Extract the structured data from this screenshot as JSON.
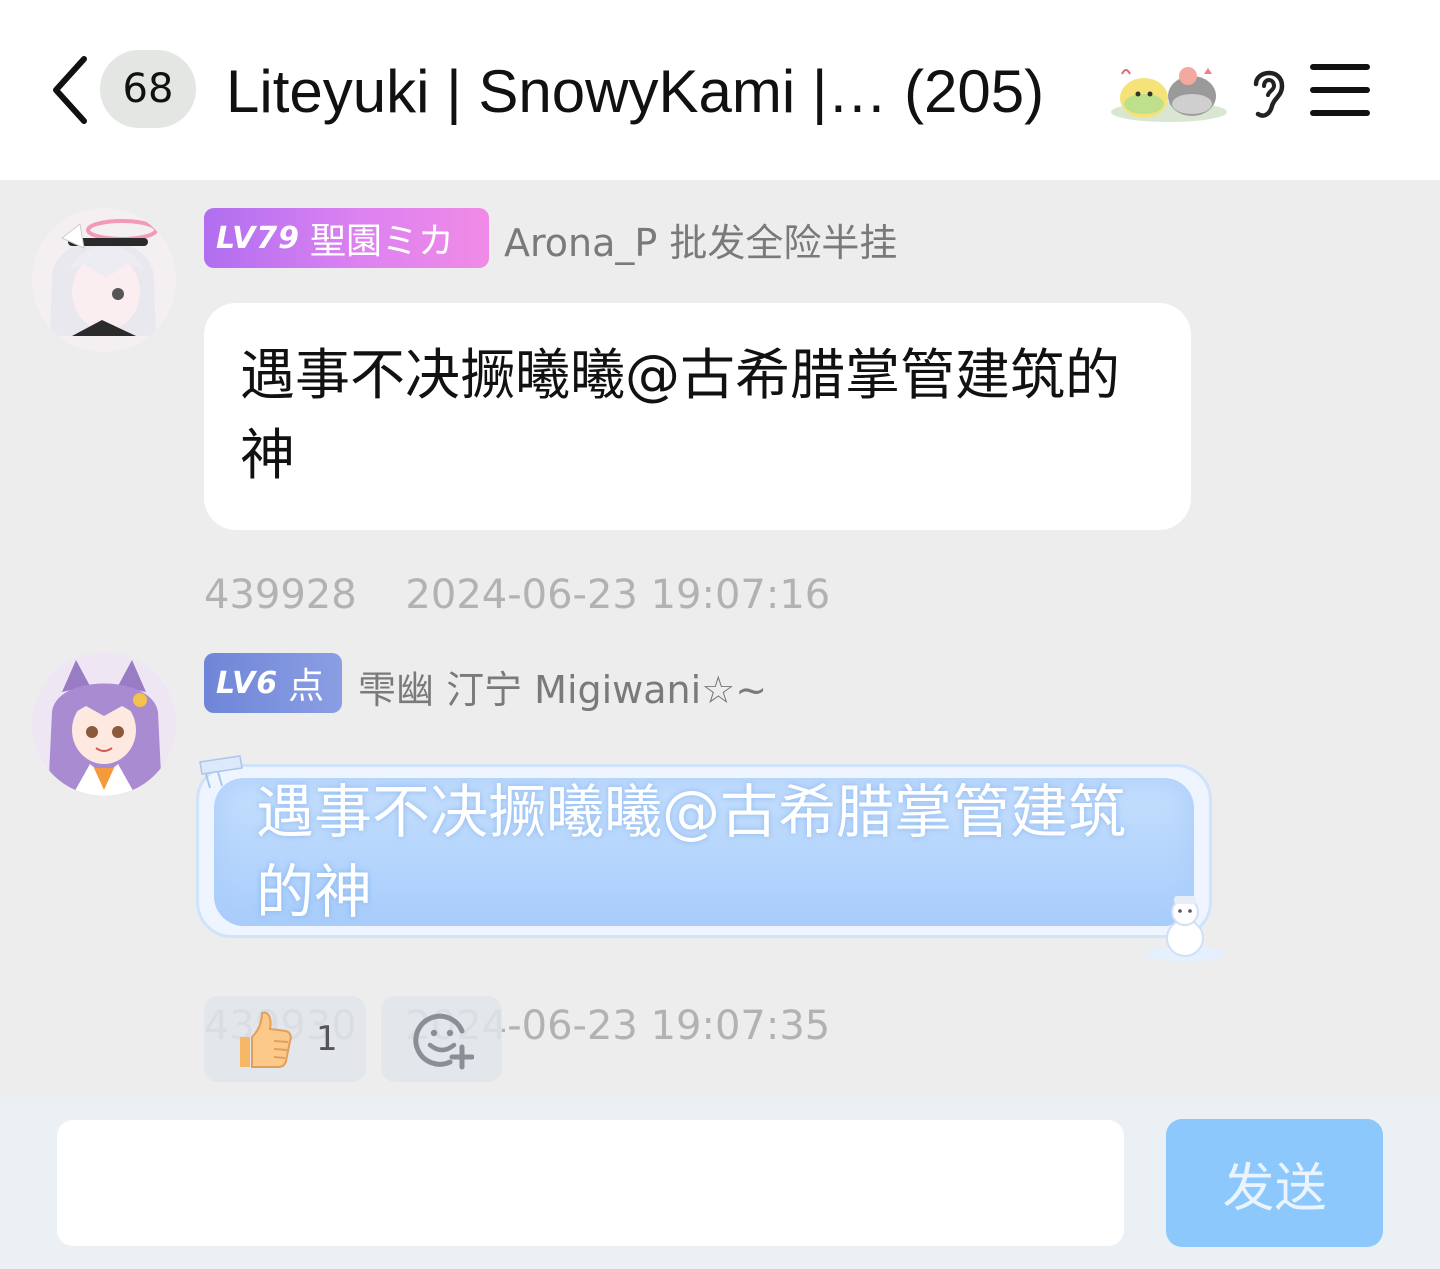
{
  "header": {
    "unread_count": "68",
    "title": "Liteyuki | SnowyKami |… (205)",
    "back_icon": "chevron-left-icon",
    "listen_icon": "ear-icon",
    "menu_icon": "hamburger-menu-icon"
  },
  "messages": [
    {
      "level": "LV79",
      "level_title": "聖園ミカ",
      "sender": "Arona_P 批发全险半挂",
      "text": "遇事不决撅曦曦@古希腊掌管建筑的神",
      "msg_id": "439928",
      "timestamp": "2024-06-23 19:07:16"
    },
    {
      "level": "LV6",
      "level_title": "点",
      "sender": "雫幽 汀宁 Migiwani☆~",
      "text": "遇事不决撅曦曦@古希腊掌管建筑的神",
      "msg_id": "439930",
      "timestamp": "2024-06-23 19:07:35",
      "reactions": [
        {
          "emoji": "thumbs-up-icon",
          "count": "1"
        },
        {
          "emoji": "add-reaction-icon"
        }
      ]
    }
  ],
  "composer": {
    "input_value": "",
    "send_label": "发送"
  },
  "colors": {
    "header_bg": "#ffffff",
    "chat_bg": "#ededed",
    "badge_lv79": "#c77cf0",
    "badge_lv6": "#7b90dc",
    "send_button": "#8cc8fb"
  }
}
